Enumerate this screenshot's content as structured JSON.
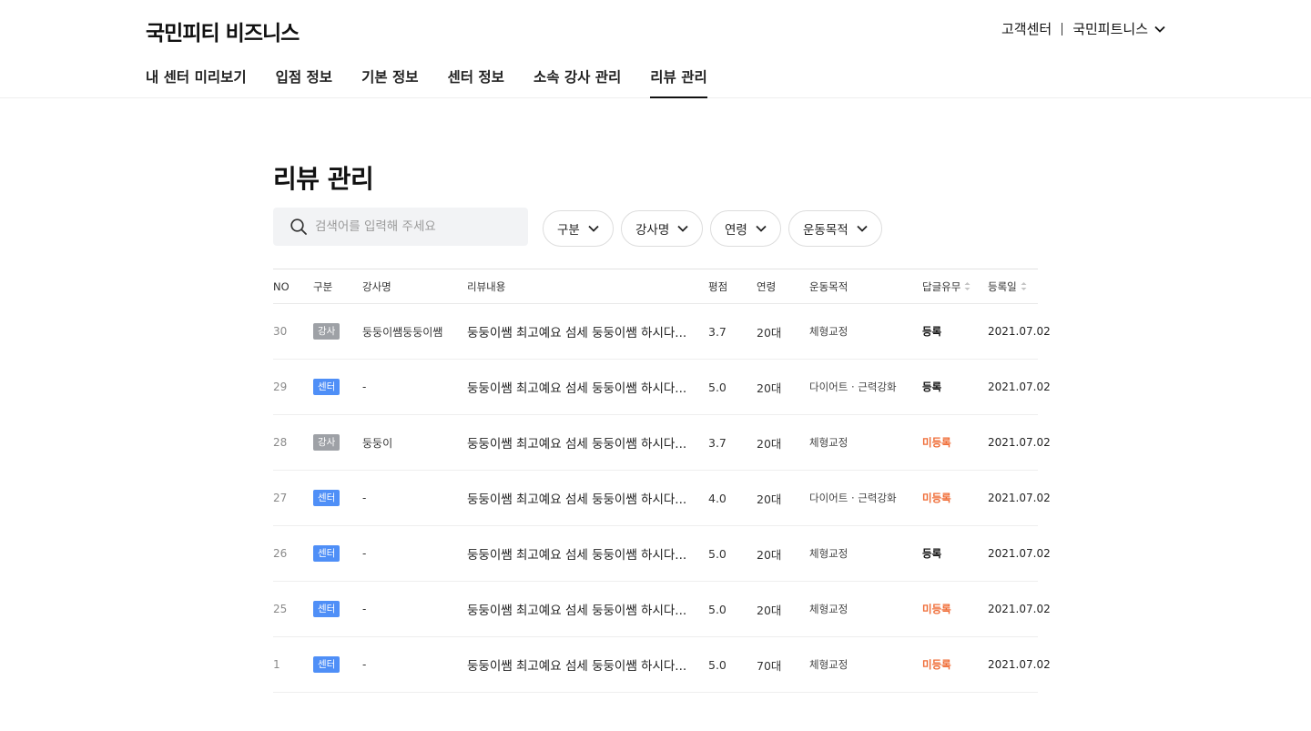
{
  "header": {
    "logo_main": "국민피티",
    "logo_sub": "비즈니스",
    "support_label": "고객센터",
    "account_label": "국민피트니스"
  },
  "nav": {
    "items": [
      {
        "label": "내 센터 미리보기"
      },
      {
        "label": "입점 정보"
      },
      {
        "label": "기본 정보"
      },
      {
        "label": "센터 정보"
      },
      {
        "label": "소속 강사 관리"
      },
      {
        "label": "리뷰 관리"
      }
    ],
    "active": "리뷰 관리"
  },
  "page": {
    "title": "리뷰 관리"
  },
  "search": {
    "placeholder": "검색어를 입력해 주세요",
    "value": ""
  },
  "filters": [
    {
      "label": "구분"
    },
    {
      "label": "강사명"
    },
    {
      "label": "연령"
    },
    {
      "label": "운동목적"
    }
  ],
  "table": {
    "columns": {
      "no": "NO",
      "type": "구분",
      "instructor": "강사명",
      "review": "리뷰내용",
      "rating": "평점",
      "age": "연령",
      "purpose": "운동목적",
      "reply": "답글유무",
      "date": "등록일"
    },
    "rows": [
      {
        "no": "30",
        "type": "강사",
        "type_kind": "instructor",
        "instructor": "둥둥이쌤둥둥이쌤",
        "review": "둥둥이쌤 최고예요 섬세 둥둥이쌤 하시다...",
        "rating": "3.7",
        "age": "20대",
        "purpose": "체형교정",
        "reply": "등록",
        "reply_kind": "on",
        "date": "2021.07.02"
      },
      {
        "no": "29",
        "type": "센터",
        "type_kind": "center",
        "instructor": "-",
        "review": "둥둥이쌤 최고예요 섬세 둥둥이쌤 하시다...",
        "rating": "5.0",
        "age": "20대",
        "purpose": "다이어트 · 근력강화",
        "reply": "등록",
        "reply_kind": "on",
        "date": "2021.07.02"
      },
      {
        "no": "28",
        "type": "강사",
        "type_kind": "instructor",
        "instructor": "둥둥이",
        "review": "둥둥이쌤 최고예요 섬세 둥둥이쌤 하시다...",
        "rating": "3.7",
        "age": "20대",
        "purpose": "체형교정",
        "reply": "미등록",
        "reply_kind": "off",
        "date": "2021.07.02"
      },
      {
        "no": "27",
        "type": "센터",
        "type_kind": "center",
        "instructor": "-",
        "review": "둥둥이쌤 최고예요 섬세 둥둥이쌤 하시다...",
        "rating": "4.0",
        "age": "20대",
        "purpose": "다이어트 · 근력강화",
        "reply": "미등록",
        "reply_kind": "off",
        "date": "2021.07.02"
      },
      {
        "no": "26",
        "type": "센터",
        "type_kind": "center",
        "instructor": "-",
        "review": "둥둥이쌤 최고예요 섬세 둥둥이쌤 하시다...",
        "rating": "5.0",
        "age": "20대",
        "purpose": "체형교정",
        "reply": "등록",
        "reply_kind": "on",
        "date": "2021.07.02"
      },
      {
        "no": "25",
        "type": "센터",
        "type_kind": "center",
        "instructor": "-",
        "review": "둥둥이쌤 최고예요 섬세 둥둥이쌤 하시다...",
        "rating": "5.0",
        "age": "20대",
        "purpose": "체형교정",
        "reply": "미등록",
        "reply_kind": "off",
        "date": "2021.07.02"
      },
      {
        "no": "1",
        "type": "센터",
        "type_kind": "center",
        "instructor": "-",
        "review": "둥둥이쌤 최고예요 섬세 둥둥이쌤 하시다...",
        "rating": "5.0",
        "age": "70대",
        "purpose": "체형교정",
        "reply": "미등록",
        "reply_kind": "off",
        "date": "2021.07.02"
      }
    ]
  },
  "colors": {
    "center_badge": "#4f8ff7",
    "instructor_badge": "#9ea1a6",
    "reply_off": "#ef6b35",
    "reply_on": "#111111"
  }
}
